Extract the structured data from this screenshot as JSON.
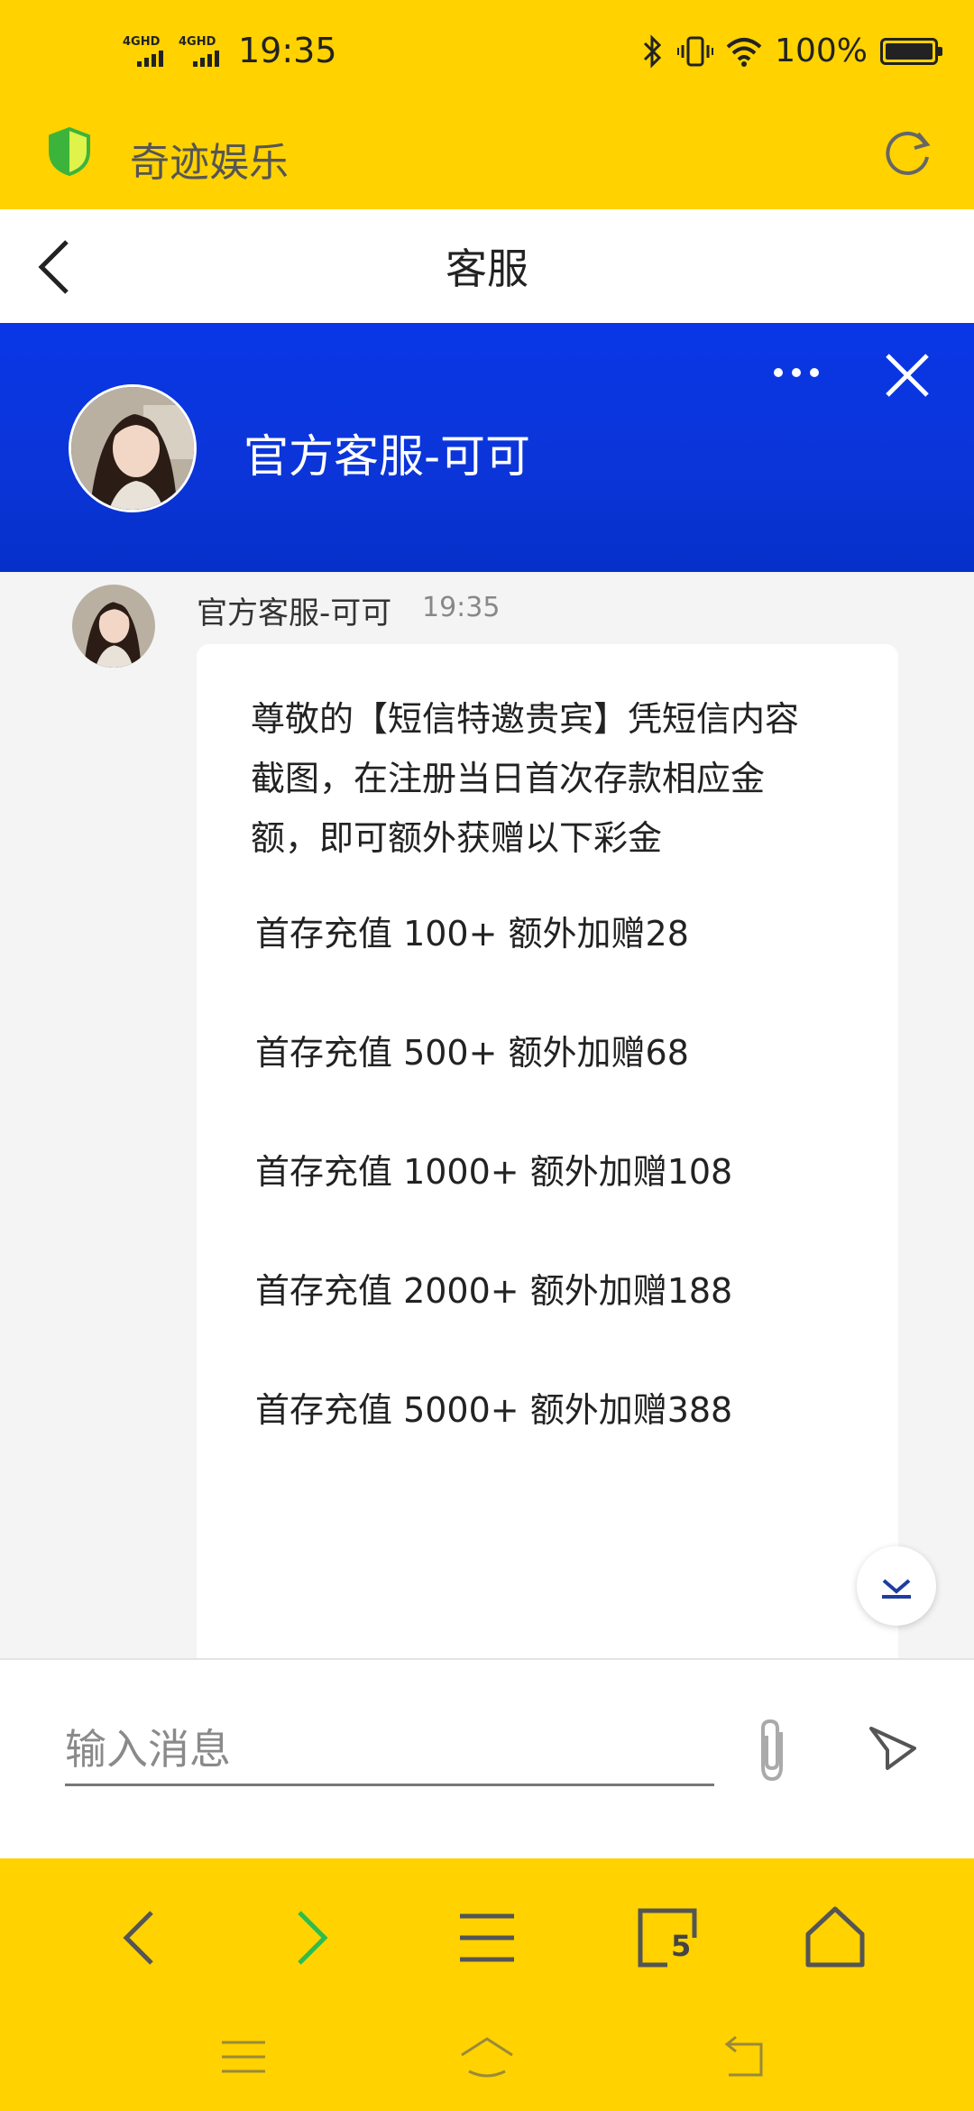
{
  "status_bar": {
    "network_1": "4GHD",
    "network_2": "4GHD",
    "time": "19:35",
    "battery_level": "100%",
    "icons": [
      "bluetooth-icon",
      "vibrate-icon",
      "wifi-icon",
      "battery-icon"
    ]
  },
  "browser": {
    "site_title": "奇迹娱乐",
    "tab_count": "5",
    "colors": {
      "bar": "#ffd200",
      "forward_active": "#2dbd4e"
    }
  },
  "page": {
    "title": "客服"
  },
  "chat_header": {
    "agent_name": "官方客服-可可",
    "color": "#0a37e6"
  },
  "message": {
    "sender": "官方客服-可可",
    "time": "19:35",
    "intro": "尊敬的【短信特邀贵宾】凭短信内容截图，在注册当日首次存款相应金额，即可额外获赠以下彩金",
    "lines": [
      "首存充值 100+ 额外加赠28",
      "首存充值 500+ 额外加赠68",
      "首存充值 1000+ 额外加赠108",
      "首存充值 2000+ 额外加赠188",
      "首存充值 5000+ 额外加赠388"
    ]
  },
  "composer": {
    "placeholder": "输入消息"
  }
}
